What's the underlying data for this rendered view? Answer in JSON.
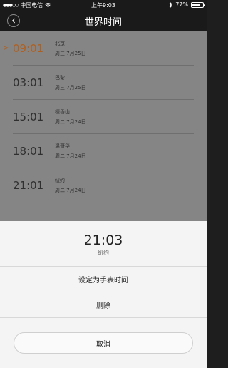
{
  "status_bar": {
    "carrier": "中国电信",
    "time": "上午9:03",
    "battery_percent_text": "77%",
    "battery_level": 0.77
  },
  "nav": {
    "title": "世界时间",
    "back_icon": "chevron-left-icon"
  },
  "clocks": [
    {
      "time": "09:01",
      "city": "北京",
      "date": "周三  7月25日",
      "selected": true
    },
    {
      "time": "03:01",
      "city": "巴黎",
      "date": "周三  7月25日",
      "selected": false
    },
    {
      "time": "15:01",
      "city": "檀香山",
      "date": "周二  7月24日",
      "selected": false
    },
    {
      "time": "18:01",
      "city": "温哥华",
      "date": "周二  7月24日",
      "selected": false
    },
    {
      "time": "21:01",
      "city": "纽约",
      "date": "周二  7月24日",
      "selected": false
    }
  ],
  "action_sheet": {
    "time": "21:03",
    "city": "纽约",
    "actions": [
      {
        "label": "设定为手表时间"
      },
      {
        "label": "删除"
      }
    ],
    "cancel_label": "取消"
  },
  "colors": {
    "accent": "#b35f1c",
    "status_bar_bg": "#1a1a1a",
    "list_overlay_bg": "#858585",
    "sheet_bg": "#f4f4f4"
  }
}
